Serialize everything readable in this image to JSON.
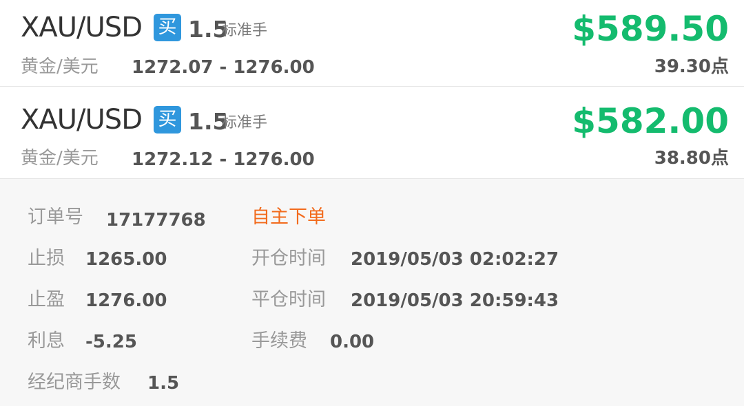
{
  "trades": [
    {
      "symbol": "XAU/USD",
      "direction": "买",
      "lots": "1.5",
      "lots_unit": "标准手",
      "profit": "$589.50",
      "name_cn": "黄金/美元",
      "price_range": "1272.07 - 1276.00",
      "points": "39.30点"
    },
    {
      "symbol": "XAU/USD",
      "direction": "买",
      "lots": "1.5",
      "lots_unit": "标准手",
      "profit": "$582.00",
      "name_cn": "黄金/美元",
      "price_range": "1272.12 - 1276.00",
      "points": "38.80点"
    }
  ],
  "details": {
    "order_no_label": "订单号",
    "order_no": "17177768",
    "order_type": "自主下单",
    "stop_loss_label": "止损",
    "stop_loss": "1265.00",
    "open_time_label": "开仓时间",
    "open_time": "2019/05/03 02:02:27",
    "take_profit_label": "止盈",
    "take_profit": "1276.00",
    "close_time_label": "平仓时间",
    "close_time": "2019/05/03 20:59:43",
    "interest_label": "利息",
    "interest": "-5.25",
    "fee_label": "手续费",
    "fee": "0.00",
    "broker_lots_label": "经纪商手数",
    "broker_lots": "1.5"
  },
  "colors": {
    "profit_green": "#14bb6e",
    "buy_badge_blue": "#2f97dd",
    "order_type_orange": "#f26b1d",
    "details_bg": "#f7f7f7"
  }
}
